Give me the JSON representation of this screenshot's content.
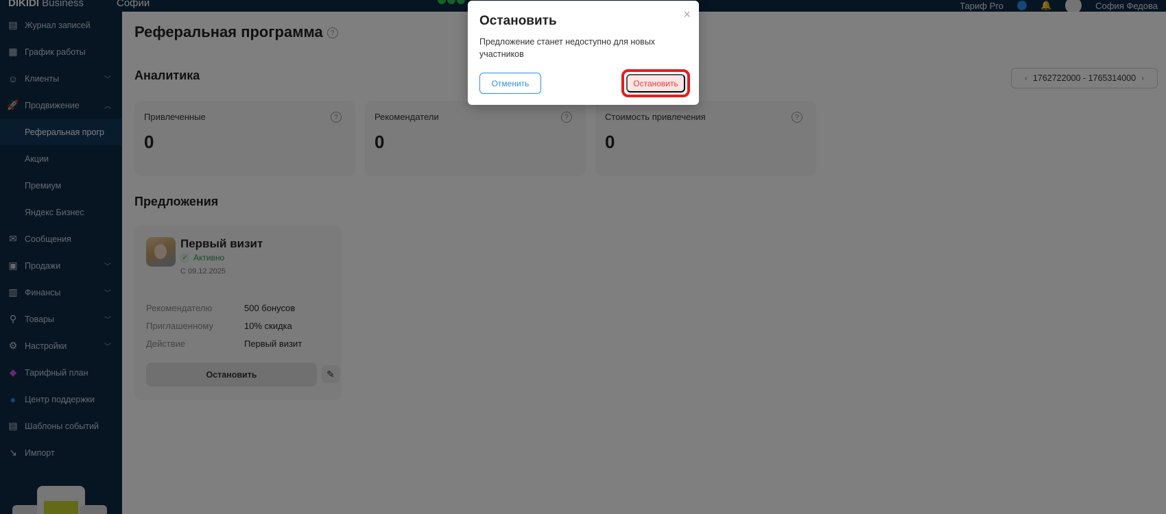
{
  "topbar": {
    "brand_bold": "DIKIDI",
    "brand_light": "Business",
    "company": "Софии",
    "tariff": "Тариф Pro",
    "user": "София Федова"
  },
  "sidebar": {
    "items": [
      {
        "label": "Журнал записей",
        "icon": "journal-icon"
      },
      {
        "label": "График работы",
        "icon": "calendar-icon"
      },
      {
        "label": "Клиенты",
        "icon": "clients-icon"
      },
      {
        "label": "Продвижение",
        "icon": "rocket-icon"
      },
      {
        "label": "Реферальная прогр"
      },
      {
        "label": "Акции"
      },
      {
        "label": "Премиум"
      },
      {
        "label": "Яндекс Бизнес"
      },
      {
        "label": "Сообщения",
        "icon": "messages-icon"
      },
      {
        "label": "Продажи",
        "icon": "sales-icon"
      },
      {
        "label": "Финансы",
        "icon": "finance-icon"
      },
      {
        "label": "Товары",
        "icon": "goods-icon"
      },
      {
        "label": "Настройки",
        "icon": "gear-icon"
      },
      {
        "label": "Тарифный план",
        "icon": "layers-icon"
      },
      {
        "label": "Центр поддержки",
        "icon": "help-icon"
      },
      {
        "label": "Шаблоны событий",
        "icon": "template-icon"
      },
      {
        "label": "Импорт",
        "icon": "import-icon"
      }
    ]
  },
  "main": {
    "title": "Реферальная программа",
    "analytics_title": "Аналитика",
    "date_range": "1762722000 - 1765314000",
    "stats": [
      {
        "label": "Привлеченные",
        "value": "0"
      },
      {
        "label": "Рекомендатели",
        "value": "0"
      },
      {
        "label": "Стоимость привлечения",
        "value": "0"
      }
    ],
    "offers_title": "Предложения",
    "offer": {
      "title": "Первый визит",
      "status": "Активно",
      "since": "С 09.12.2025",
      "rows": [
        {
          "k": "Рекомендателю",
          "v": "500 бонусов"
        },
        {
          "k": "Приглашенному",
          "v": "10% скидка"
        },
        {
          "k": "Действие",
          "v": "Первый визит"
        }
      ],
      "stop_label": "Остановить"
    }
  },
  "modal": {
    "title": "Остановить",
    "text": "Предложение станет недоступно для новых участников",
    "cancel_label": "Отменить",
    "confirm_label": "Остановить"
  },
  "colors": {
    "sidebar_bg": "#0e2a44",
    "accent": "#2a8ff0",
    "success": "#2f9e50",
    "danger": "#e41d1d"
  }
}
